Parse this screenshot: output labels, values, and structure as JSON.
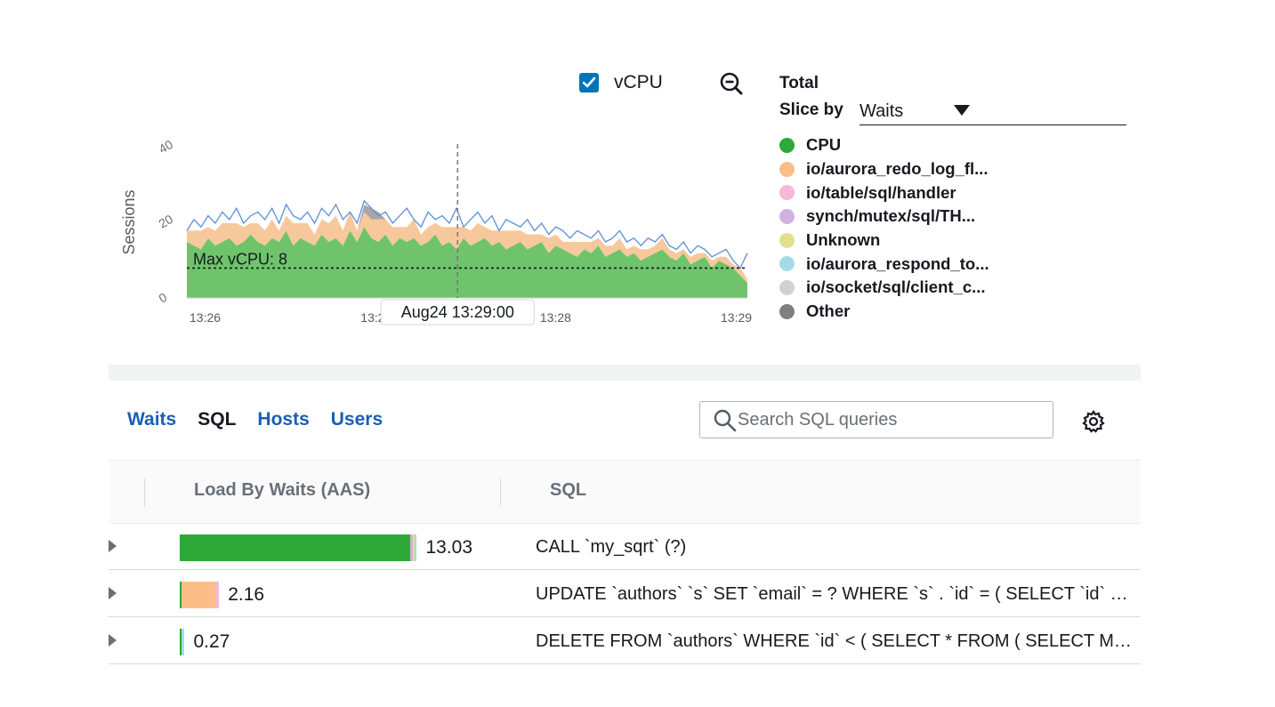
{
  "chart_controls": {
    "vcpu_checkbox_checked": true,
    "vcpu_label": "vCPU",
    "zoom_icon": "zoom-out-icon"
  },
  "legend": {
    "title": "Total",
    "slice_by_label": "Slice by",
    "slice_by_value": "Waits",
    "items": [
      {
        "label": "CPU",
        "color": "#2ea836"
      },
      {
        "label": "io/aurora_redo_log_fl...",
        "color": "#fbbe86"
      },
      {
        "label": "io/table/sql/handler",
        "color": "#f5b8d6"
      },
      {
        "label": "synch/mutex/sql/TH...",
        "color": "#cfb2e0"
      },
      {
        "label": "Unknown",
        "color": "#e0e08f"
      },
      {
        "label": "io/aurora_respond_to...",
        "color": "#a3dce8"
      },
      {
        "label": "io/socket/sql/client_c...",
        "color": "#d1d1d1"
      },
      {
        "label": "Other",
        "color": "#7f7f7f"
      }
    ]
  },
  "chart_data": {
    "type": "area",
    "ylabel": "Sessions",
    "ylim": [
      0,
      40
    ],
    "yticks": [
      "0",
      "20",
      "40"
    ],
    "xticks": [
      "13:26",
      "13:27",
      "13:28",
      "13:29"
    ],
    "threshold": {
      "label": "Max vCPU: 8",
      "value": 8
    },
    "cursor_label": "Aug24 13:29:00",
    "series": [
      {
        "name": "CPU",
        "values": [
          15,
          14,
          13,
          16,
          14,
          15,
          16,
          14,
          15,
          17,
          15,
          14,
          16,
          15,
          18,
          14,
          16,
          15,
          14,
          17,
          15,
          16,
          14,
          18,
          15,
          19,
          16,
          15,
          17,
          14,
          16,
          15,
          16,
          14,
          15,
          17,
          14,
          15,
          13,
          16,
          14,
          15,
          16,
          14,
          15,
          13,
          14,
          15,
          13,
          14,
          15,
          12,
          14,
          13,
          12,
          11,
          13,
          12,
          14,
          11,
          12,
          13,
          11,
          12,
          10,
          11,
          12,
          13,
          11,
          10,
          12,
          9,
          10,
          11,
          8,
          10,
          9,
          8,
          6,
          4
        ]
      },
      {
        "name": "io/aurora_redo_log_fl...",
        "values": [
          3,
          4,
          5,
          3,
          4,
          5,
          4,
          6,
          4,
          3,
          5,
          4,
          5,
          3,
          4,
          6,
          4,
          5,
          3,
          4,
          5,
          6,
          4,
          5,
          3,
          4,
          5,
          6,
          4,
          5,
          3,
          4,
          5,
          3,
          4,
          3,
          5,
          4,
          6,
          3,
          4,
          5,
          3,
          4,
          3,
          5,
          4,
          3,
          4,
          3,
          2,
          4,
          3,
          2,
          3,
          4,
          2,
          3,
          2,
          3,
          2,
          3,
          2,
          2,
          3,
          2,
          2,
          3,
          2,
          2,
          1,
          2,
          2,
          1,
          2,
          1,
          2,
          1,
          2,
          1
        ]
      },
      {
        "name": "Other",
        "values": [
          0,
          0,
          0,
          0,
          0,
          0,
          0,
          0,
          0,
          0,
          0,
          0,
          0,
          0,
          0,
          0,
          0,
          0,
          0,
          0,
          0,
          0,
          0,
          0,
          0,
          2,
          3,
          2,
          0,
          0,
          0,
          0,
          0,
          0,
          0,
          0,
          0,
          0,
          0,
          0,
          0,
          0,
          0,
          0,
          0,
          0,
          0,
          0,
          0,
          0,
          0,
          0,
          0,
          0,
          0,
          0,
          0,
          0,
          0,
          0,
          0,
          0,
          0,
          0,
          0,
          0,
          0,
          0,
          0,
          0,
          0,
          0,
          0,
          0,
          0,
          0,
          0,
          0,
          0,
          0
        ]
      },
      {
        "name": "Total",
        "values": [
          18,
          21,
          19,
          22,
          20,
          23,
          21,
          24,
          20,
          22,
          23,
          21,
          24,
          20,
          25,
          22,
          21,
          23,
          20,
          24,
          22,
          25,
          21,
          23,
          20,
          26,
          24,
          22,
          23,
          20,
          22,
          24,
          21,
          19,
          23,
          21,
          22,
          20,
          24,
          19,
          21,
          23,
          20,
          22,
          18,
          21,
          20,
          19,
          21,
          18,
          20,
          17,
          19,
          18,
          16,
          18,
          17,
          16,
          18,
          15,
          16,
          18,
          15,
          16,
          14,
          16,
          15,
          17,
          14,
          13,
          15,
          12,
          14,
          13,
          11,
          12,
          13,
          10,
          8,
          12
        ]
      }
    ]
  },
  "tabs": [
    {
      "label": "Waits",
      "active": false
    },
    {
      "label": "SQL",
      "active": true
    },
    {
      "label": "Hosts",
      "active": false
    },
    {
      "label": "Users",
      "active": false
    }
  ],
  "search": {
    "placeholder": "Search SQL queries"
  },
  "settings_icon": "gear-icon",
  "table": {
    "columns": [
      "Load By Waits (AAS)",
      "SQL"
    ],
    "rows": [
      {
        "value": "13.03",
        "sql": "CALL `my_sqrt` (?)",
        "segments": [
          {
            "color": "#2ea836",
            "amount": 12.75
          },
          {
            "color": "#cfb2e0",
            "amount": 0.18
          },
          {
            "color": "#e0e08f",
            "amount": 0.05
          },
          {
            "color": "#a3dce8",
            "amount": 0.05
          }
        ]
      },
      {
        "value": "2.16",
        "sql": "UPDATE `authors` `s` SET `email` = ? WHERE `s` . `id` = ( SELECT `id` FROM `authors` ORDER BY RAND ( ) LIMIT ? )",
        "segments": [
          {
            "color": "#2ea836",
            "amount": 0.08
          },
          {
            "color": "#fbbe86",
            "amount": 1.88
          },
          {
            "color": "#f5b8d6",
            "amount": 0.2
          }
        ]
      },
      {
        "value": "0.27",
        "sql": "DELETE FROM `authors` WHERE `id` < ( SELECT * FROM ( SELECT MIN ( `id` ) FROM `authors` ) AS `t` )",
        "segments": [
          {
            "color": "#2ea836",
            "amount": 0.1
          },
          {
            "color": "#a3dce8",
            "amount": 0.17
          }
        ]
      }
    ]
  }
}
